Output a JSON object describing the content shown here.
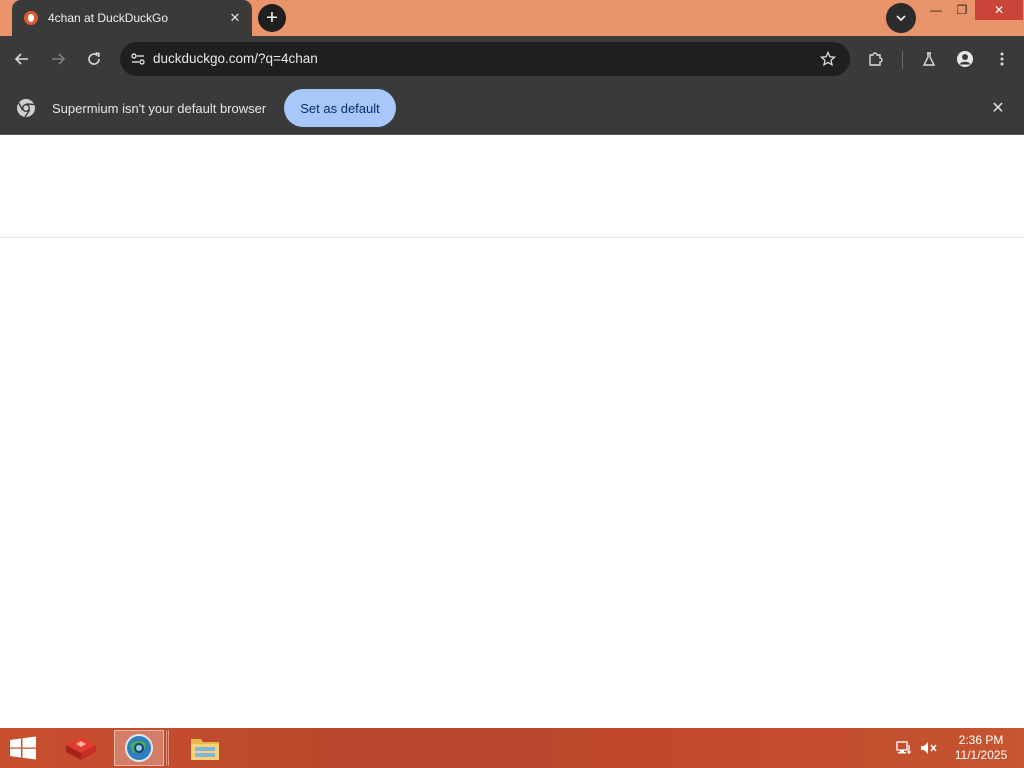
{
  "browser": {
    "tab": {
      "title": "4chan at DuckDuckGo",
      "favicon_icon": "duckduckgo-icon",
      "close_label": "✕"
    },
    "new_tab_label": "+",
    "omnibox": {
      "url": "duckduckgo.com/?q=4chan"
    },
    "window_controls": {
      "minimize": "—",
      "restore": "❐",
      "close": "✕"
    }
  },
  "infobar": {
    "message": "Supermium isn't your default browser",
    "button_label": "Set as default",
    "close_label": "✕"
  },
  "taskbar": {
    "clock": {
      "time": "2:36 PM",
      "date": "11/1/2025"
    }
  },
  "colors": {
    "titlebar": "#e9936a",
    "toolbar": "#3a3a3a",
    "omnibox": "#1f1f1f",
    "accent_button": "#a8c7fa",
    "taskbar": "#c24a2d",
    "close_button": "#c9453a"
  }
}
